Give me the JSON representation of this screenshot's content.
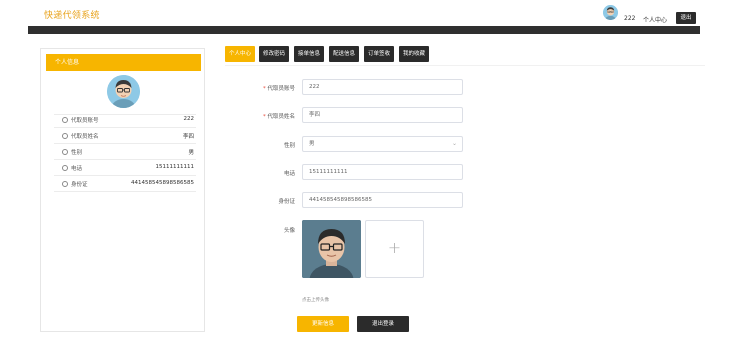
{
  "header": {
    "app_title": "快递代领系统",
    "username": "222",
    "personal_center": "个人中心",
    "logout": "退出"
  },
  "left_card": {
    "title": "个人信息",
    "rows": [
      {
        "label": "代取员账号",
        "value": "222"
      },
      {
        "label": "代取员姓名",
        "value": "李四"
      },
      {
        "label": "性别",
        "value": "男"
      },
      {
        "label": "电话",
        "value": "15111111111"
      },
      {
        "label": "身份证",
        "value": "441458545898586585"
      }
    ]
  },
  "tabs": [
    "个人中心",
    "修改密码",
    "接单信息",
    "配送信息",
    "订单签收",
    "我的收藏"
  ],
  "form": {
    "account": {
      "label": "代取员账号",
      "value": "222"
    },
    "name": {
      "label": "代取员姓名",
      "value": "李四"
    },
    "gender": {
      "label": "性别",
      "value": "男"
    },
    "phone": {
      "label": "电话",
      "value": "15111111111"
    },
    "idcard": {
      "label": "身份证",
      "value": "441458545898586585"
    },
    "avatar_label": "头像",
    "upload_tip": "点击上传头像",
    "update_button": "更新信息",
    "logout_button": "退出登录"
  },
  "colors": {
    "accent": "#f7b500",
    "dark": "#2b2b2b",
    "brand_text": "#e8a21a"
  },
  "icons": [
    "avatar-icon",
    "user-circle-icon",
    "chevron-down-icon",
    "plus-icon"
  ]
}
